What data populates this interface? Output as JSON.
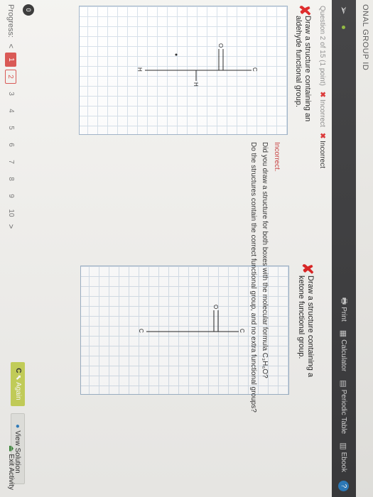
{
  "header": {
    "title": "ONAL GROUP ID",
    "tools": [
      {
        "icon": "print-icon",
        "label": "Print"
      },
      {
        "icon": "calculator-icon",
        "label": "Calculator"
      },
      {
        "icon": "periodic-table-icon",
        "label": "Periodic Table"
      },
      {
        "icon": "ebook-icon",
        "label": "Ebook"
      }
    ],
    "help_label": "?"
  },
  "question": {
    "info": "Question 2 of 15 (1 point)",
    "status_1": "Incorrect",
    "status_2": "Incorrect",
    "status_mark": "✖"
  },
  "panels": [
    {
      "prompt_line1": "Draw a structure containing an",
      "prompt_line2": "aldehyde functional group.",
      "mark": "✘"
    },
    {
      "prompt_line1": "Draw a structure containing a",
      "prompt_line2": "ketone functional group.",
      "mark": "✘"
    }
  ],
  "molecules": {
    "aldehyde": {
      "c": "C",
      "o": "O",
      "h": "H"
    },
    "ketone": {
      "c": "C",
      "o": "O"
    }
  },
  "feedback": {
    "heading": "Incorrect.",
    "line1": "Did you draw a structure for both boxes with the molecular formula C₃H₆O?",
    "line2": "Do the structures contain the correct functional group, and no extra functional groups?"
  },
  "actions": {
    "again_prefix": "C",
    "again_label": "Again",
    "view_label": "View Solution"
  },
  "progress": {
    "label": "Progress:",
    "pages": [
      "1",
      "2",
      "3",
      "4",
      "5",
      "6",
      "7",
      "8",
      "9",
      "10"
    ],
    "prev": "<",
    "next": ">",
    "exit_label": "Exit Activity",
    "badge": "0"
  },
  "colors": {
    "topbar": "#3c3c3e",
    "incorrect_red": "#d22222",
    "again_button": "#c9d45a",
    "grid_line": "#d6e0ea"
  }
}
